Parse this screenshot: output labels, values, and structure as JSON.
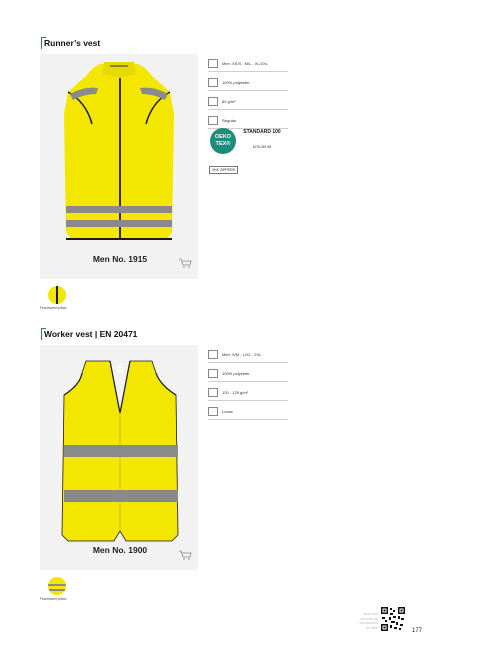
{
  "section1": {
    "title": "Runner’s vest",
    "model": "Men No. 1915",
    "specs": [
      {
        "icon": "size-icon",
        "text": "Men: XS/S - M/L - XL/2XL"
      },
      {
        "icon": "fabric-icon",
        "text": "100% polyester"
      },
      {
        "icon": "weight-icon",
        "text": "60 g/m²"
      },
      {
        "icon": "fit-icon",
        "text": "Regular"
      }
    ],
    "oeko": {
      "logo_top": "OEKO",
      "logo_bottom": "TEX®",
      "standard": "STANDARD 100",
      "cert": "1076-319 IIH"
    },
    "tag": "YKK ZIPPERS",
    "color_label": "Fluorescent yellow"
  },
  "section2": {
    "title": "Worker vest | EN 20471",
    "model": "Men No. 1900",
    "specs": [
      {
        "icon": "size-icon",
        "text": "Men: S/M - L/XL - 2XL"
      },
      {
        "icon": "fabric-icon",
        "text": "100% polyester"
      },
      {
        "icon": "weight-icon",
        "text": "120 - 125 g/m²"
      },
      {
        "icon": "fit-icon",
        "text": "Loose"
      }
    ],
    "color_label": "Fluorescent yellow"
  },
  "footer": {
    "scan_text_1": "Scan and",
    "scan_text_2": "discover all",
    "scan_text_3": "accessories",
    "scan_text_4": "on Web",
    "page_number": "177"
  },
  "colors": {
    "vest_yellow": "#f3e600",
    "accent_green": "#2e7d5b",
    "oeko_teal": "#1c8d7a"
  }
}
